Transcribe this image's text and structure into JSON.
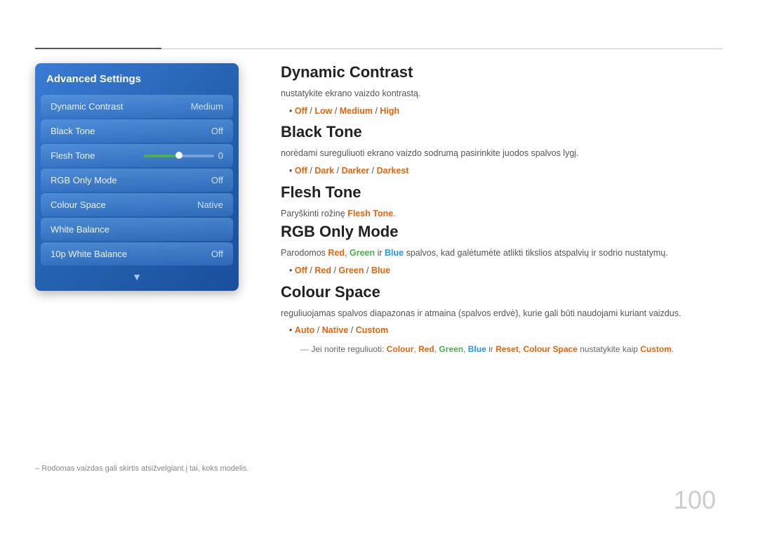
{
  "topBorder": {},
  "sidebar": {
    "title": "Advanced Settings",
    "items": [
      {
        "label": "Dynamic Contrast",
        "value": "Medium",
        "type": "text"
      },
      {
        "label": "Black Tone",
        "value": "Off",
        "type": "text"
      },
      {
        "label": "Flesh Tone",
        "value": "0",
        "type": "slider"
      },
      {
        "label": "RGB Only Mode",
        "value": "Off",
        "type": "text"
      },
      {
        "label": "Colour Space",
        "value": "Native",
        "type": "text"
      },
      {
        "label": "White Balance",
        "value": "",
        "type": "text"
      },
      {
        "label": "10p White Balance",
        "value": "Off",
        "type": "text"
      }
    ]
  },
  "sections": [
    {
      "id": "dynamic-contrast",
      "title": "Dynamic Contrast",
      "desc": "nustatykite ekrano vaizdo kontrastą.",
      "options": [
        {
          "text": "Off",
          "highlighted": true
        },
        {
          "text": " / ",
          "highlighted": false
        },
        {
          "text": "Low",
          "highlighted": true
        },
        {
          "text": " / ",
          "highlighted": false
        },
        {
          "text": "Medium",
          "highlighted": true
        },
        {
          "text": " / ",
          "highlighted": false
        },
        {
          "text": "High",
          "highlighted": true
        }
      ]
    },
    {
      "id": "black-tone",
      "title": "Black Tone",
      "desc": "norėdami sureguliuoti ekrano vaizdo sodrumą pasirinkite juodos spalvos lygį.",
      "options": [
        {
          "text": "Off",
          "highlighted": true
        },
        {
          "text": " / ",
          "highlighted": false
        },
        {
          "text": "Dark",
          "highlighted": true
        },
        {
          "text": " / ",
          "highlighted": false
        },
        {
          "text": "Darker",
          "highlighted": true
        },
        {
          "text": " / ",
          "highlighted": false
        },
        {
          "text": "Darkest",
          "highlighted": true
        }
      ]
    },
    {
      "id": "flesh-tone",
      "title": "Flesh Tone",
      "desc": "Paryškinti rožinę ",
      "desc_highlight": "Flesh Tone",
      "desc_end": "."
    },
    {
      "id": "rgb-only-mode",
      "title": "RGB Only Mode",
      "desc": "Parodomos ",
      "desc_parts": [
        {
          "text": "Red",
          "color": "orange"
        },
        {
          "text": ", ",
          "color": "normal"
        },
        {
          "text": "Green",
          "color": "green"
        },
        {
          "text": " ir ",
          "color": "normal"
        },
        {
          "text": "Blue",
          "color": "blue"
        },
        {
          "text": " spalvos, kad galėtumėte atlikti tikslios atspalvių ir sodrio nustatymų.",
          "color": "normal"
        }
      ],
      "options": [
        {
          "text": "Off",
          "highlighted": true
        },
        {
          "text": " / ",
          "highlighted": false
        },
        {
          "text": "Red",
          "highlighted": true
        },
        {
          "text": " / ",
          "highlighted": false
        },
        {
          "text": "Green",
          "highlighted": true
        },
        {
          "text": " / ",
          "highlighted": false
        },
        {
          "text": "Blue",
          "highlighted": true
        }
      ]
    },
    {
      "id": "colour-space",
      "title": "Colour Space",
      "desc": "reguliuojamas spalvos diapazonas ir atmaina (spalvos erdvė), kurie gali būti naudojami kuriant vaizdus.",
      "options": [
        {
          "text": "Auto",
          "highlighted": true
        },
        {
          "text": " / ",
          "highlighted": false
        },
        {
          "text": "Native",
          "highlighted": true
        },
        {
          "text": " / ",
          "highlighted": false
        },
        {
          "text": "Custom",
          "highlighted": true
        }
      ],
      "subnote": "Jei norite reguliuoti: Colour, Red, Green, Blue ir Reset, Colour Space nustatykite kaip Custom."
    }
  ],
  "footerNote": "Rodomas vaizdas gali skirtis atsižvelgiant į tai, koks modelis.",
  "pageNumber": "100"
}
